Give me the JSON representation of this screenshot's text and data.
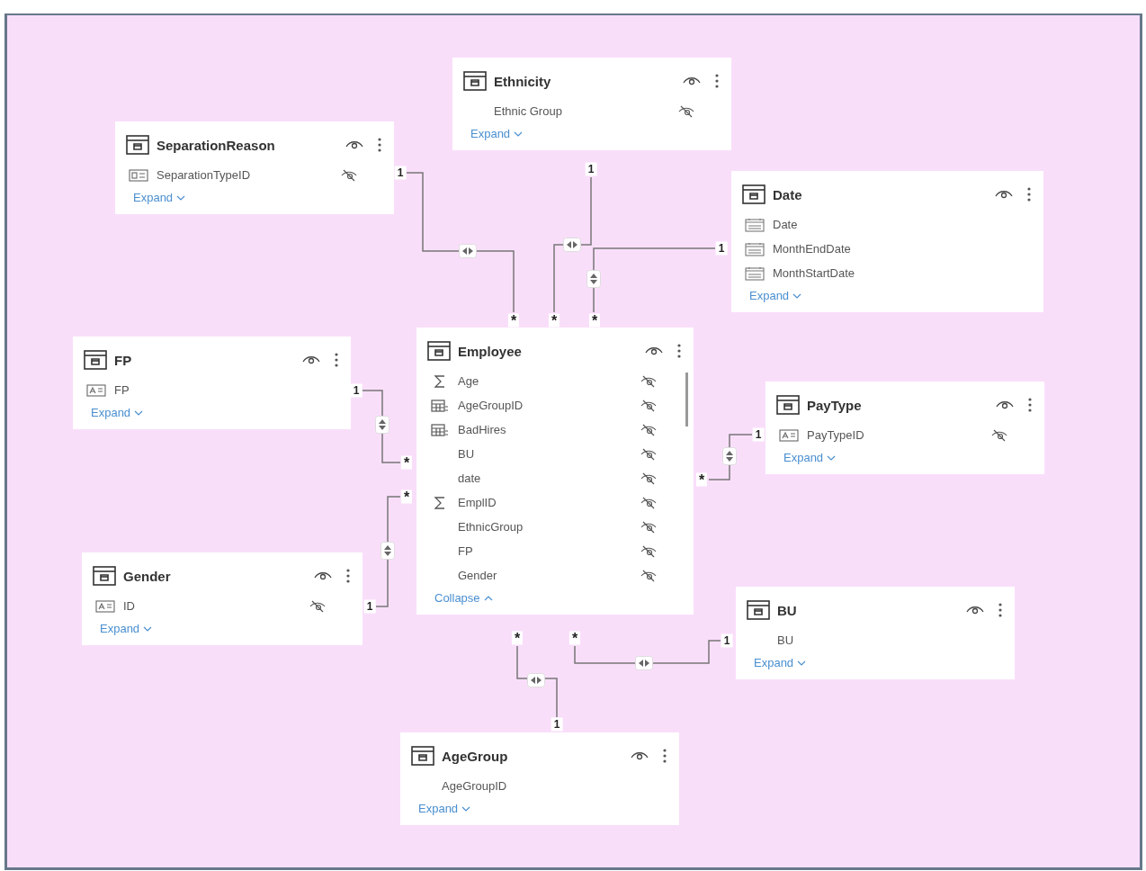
{
  "tables": [
    {
      "name": "Ethnicity",
      "fields": [
        {
          "name": "Ethnic Group",
          "kind": "none",
          "hidden": true
        }
      ],
      "footer": {
        "label": "Expand",
        "expanded": false
      }
    },
    {
      "name": "SeparationReason",
      "fields": [
        {
          "name": "SeparationTypeID",
          "kind": "card",
          "hidden": true
        }
      ],
      "footer": {
        "label": "Expand",
        "expanded": false
      }
    },
    {
      "name": "Date",
      "fields": [
        {
          "name": "Date",
          "kind": "date",
          "hidden": false
        },
        {
          "name": "MonthEndDate",
          "kind": "date",
          "hidden": false
        },
        {
          "name": "MonthStartDate",
          "kind": "date",
          "hidden": false
        }
      ],
      "footer": {
        "label": "Expand",
        "expanded": false
      }
    },
    {
      "name": "FP",
      "fields": [
        {
          "name": "FP",
          "kind": "text",
          "hidden": false
        }
      ],
      "footer": {
        "label": "Expand",
        "expanded": false
      }
    },
    {
      "name": "Employee",
      "fields": [
        {
          "name": "Age",
          "kind": "sum",
          "hidden": true
        },
        {
          "name": "AgeGroupID",
          "kind": "calc",
          "hidden": true
        },
        {
          "name": "BadHires",
          "kind": "calc",
          "hidden": true
        },
        {
          "name": "BU",
          "kind": "none",
          "hidden": true
        },
        {
          "name": "date",
          "kind": "none",
          "hidden": true
        },
        {
          "name": "EmplID",
          "kind": "sum",
          "hidden": true
        },
        {
          "name": "EthnicGroup",
          "kind": "none",
          "hidden": true
        },
        {
          "name": "FP",
          "kind": "none",
          "hidden": true
        },
        {
          "name": "Gender",
          "kind": "none",
          "hidden": true
        }
      ],
      "footer": {
        "label": "Collapse",
        "expanded": true
      }
    },
    {
      "name": "PayType",
      "fields": [
        {
          "name": "PayTypeID",
          "kind": "text",
          "hidden": true
        }
      ],
      "footer": {
        "label": "Expand",
        "expanded": false
      }
    },
    {
      "name": "Gender",
      "fields": [
        {
          "name": "ID",
          "kind": "text",
          "hidden": true
        }
      ],
      "footer": {
        "label": "Expand",
        "expanded": false
      }
    },
    {
      "name": "BU",
      "fields": [
        {
          "name": "BU",
          "kind": "none",
          "hidden": false
        }
      ],
      "footer": {
        "label": "Expand",
        "expanded": false
      }
    },
    {
      "name": "AgeGroup",
      "fields": [
        {
          "name": "AgeGroupID",
          "kind": "none",
          "hidden": false
        }
      ],
      "footer": {
        "label": "Expand",
        "expanded": false
      }
    }
  ],
  "relationships": [
    {
      "one": "1",
      "many": "*",
      "kind": "horizontal"
    },
    {
      "one": "1",
      "many": "*",
      "kind": "horizontal"
    },
    {
      "one": "1",
      "many": "*",
      "kind": "vertical"
    },
    {
      "one": "1",
      "many": "*",
      "kind": "vertical"
    },
    {
      "one": "1",
      "many": "*",
      "kind": "vertical"
    },
    {
      "one": "1",
      "many": "*",
      "kind": "vertical"
    },
    {
      "one": "1",
      "many": "*",
      "kind": "horizontal"
    },
    {
      "one": "1",
      "many": "*",
      "kind": "horizontal"
    }
  ]
}
